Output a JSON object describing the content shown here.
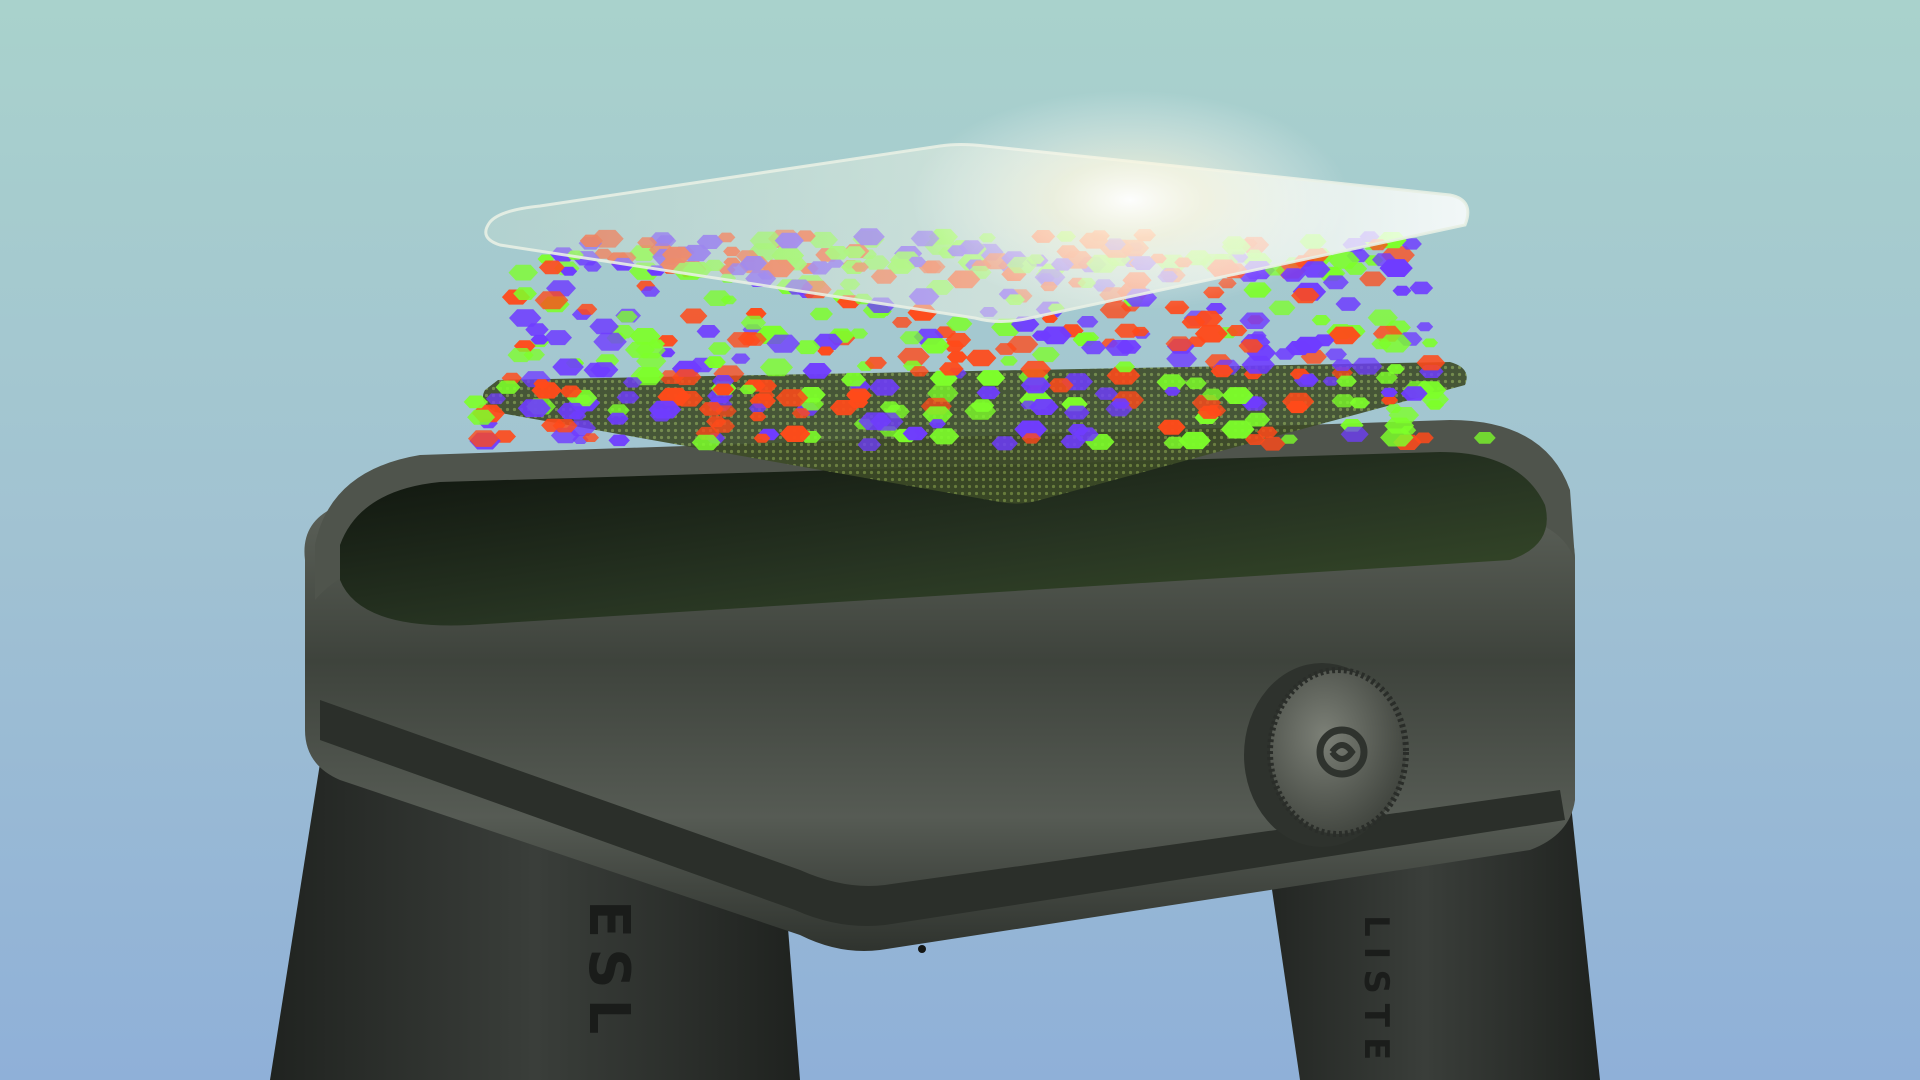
{
  "scene": {
    "subject": "smartwatch-exploded-display-layers",
    "strap_text_left": "ESL",
    "strap_text_right": "LISTE",
    "colors": {
      "bg_top": "#a9d2cc",
      "bg_mid": "#a1c2d2",
      "bg_bottom": "#8fb0d8",
      "case": "#3d423c",
      "case_edge": "#5a5f57",
      "strap": "#2c2f2c",
      "screen": "#1b2219",
      "mesh": "#4a5a2c",
      "glass_glow": "#fffbe8",
      "pixel_red": "#ff4a1a",
      "pixel_green": "#7dff2a",
      "pixel_blue": "#6f3cff"
    },
    "icons": [
      "crown-logo-icon"
    ]
  }
}
